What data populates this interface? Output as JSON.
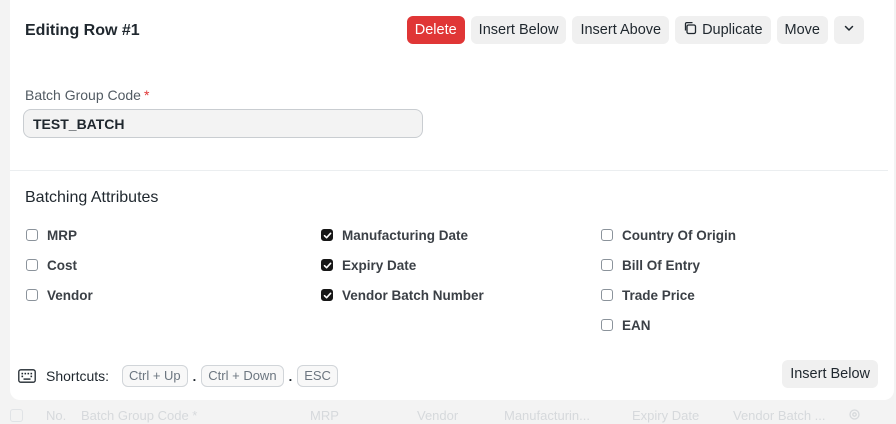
{
  "header": {
    "title": "Editing Row #1",
    "delete_label": "Delete",
    "insert_below_label": "Insert Below",
    "insert_above_label": "Insert Above",
    "duplicate_label": "Duplicate",
    "move_label": "Move",
    "more_icon": "chevron-down-icon"
  },
  "field": {
    "label": "Batch Group Code",
    "required_mark": "*",
    "value": "TEST_BATCH"
  },
  "batching": {
    "title": "Batching Attributes",
    "columns": [
      [
        {
          "label": "MRP",
          "checked": false
        },
        {
          "label": "Cost",
          "checked": false
        },
        {
          "label": "Vendor",
          "checked": false
        }
      ],
      [
        {
          "label": "Manufacturing Date",
          "checked": true
        },
        {
          "label": "Expiry Date",
          "checked": true
        },
        {
          "label": "Vendor Batch Number",
          "checked": true
        }
      ],
      [
        {
          "label": "Country Of Origin",
          "checked": false
        },
        {
          "label": "Bill Of Entry",
          "checked": false
        },
        {
          "label": "Trade Price",
          "checked": false
        },
        {
          "label": "EAN",
          "checked": false
        }
      ]
    ]
  },
  "footer": {
    "shortcuts_label": "Shortcuts:",
    "key_1": "Ctrl + Up",
    "key_2": "Ctrl + Down",
    "key_3": "ESC",
    "separator": ".",
    "insert_below_label": "Insert Below"
  },
  "grid": {
    "no": "No.",
    "batch_group_code": "Batch Group Code *",
    "mrp": "MRP",
    "vendor": "Vendor",
    "manufacturing": "Manufacturin...",
    "expiry": "Expiry Date",
    "vendor_batch": "Vendor Batch ..."
  }
}
